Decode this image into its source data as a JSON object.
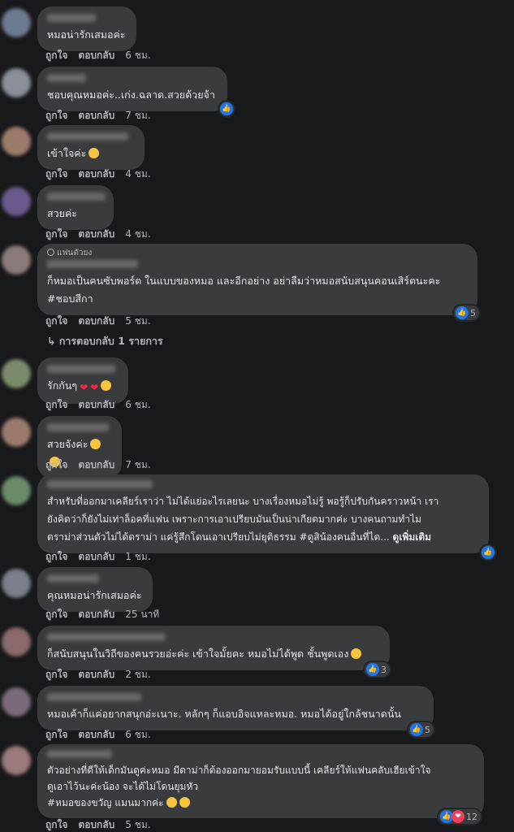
{
  "comments": [
    {
      "text": "หมอน่ารักเสมอค่ะ",
      "like": "ถูกใจ",
      "reply": "ตอบกลับ",
      "time": "6 ชม.",
      "avatar_color": "#6c7a8f"
    },
    {
      "text": "ชอบคุณหมอค่ะ..เก่ง.ฉลาด.สวยด้วยจ้า",
      "like": "ถูกใจ",
      "reply": "ตอบกลับ",
      "time": "7 ชม.",
      "avatar_color": "#8a8f99"
    },
    {
      "text": "เข้าใจค่ะ",
      "like": "ถูกใจ",
      "reply": "ตอบกลับ",
      "time": "4 ชม.",
      "avatar_color": "#9b7b6a"
    },
    {
      "text": "สวยค่ะ",
      "like": "ถูกใจ",
      "reply": "ตอบกลับ",
      "time": "4 ชม.",
      "avatar_color": "#6a5a8c"
    },
    {
      "badge": "แฟนตัวยง",
      "text": "ก็หมอเป็นคนซับพอร์ต ในแบบของหมอ และอีกอย่าง อย่าลืมว่าหมอสนับสนุนคอนเสิร์ตนะคะ\n#ชอบสีกา",
      "like": "ถูกใจ",
      "reply": "ตอบกลับ",
      "time": "5 ชม.",
      "reactions": "5",
      "avatar_color": "#8a7a7a"
    },
    {
      "text": "รักกันๆ",
      "like": "ถูกใจ",
      "reply": "ตอบกลับ",
      "time": "6 ชม.",
      "avatar_color": "#7a8a6a"
    },
    {
      "text": "สวยจังค่ะ",
      "like": "ถูกใจ",
      "reply": "ตอบกลับ",
      "time": "7 ชม.",
      "avatar_color": "#9a7a6a"
    },
    {
      "text": "สำหรับที่ออกมาเคลียร์เราว่า ไม่ได้แย่อะไรเลยนะ บางเรื่องหมอไม่รู้ พอรู้ก็ปรับกันคราวหน้า เรา\nยังคิดว่าก็ยังไม่เท่าล็อคที่แฟน เพราะการเอาเปรียบมันเป็นน่าเกียดมากค่ะ บางคนถามทำไม\nดราม่าส่วนตัวไม่ได้ดราม่า แค่รู้สึกโดนเอาเปรียบไม่ยุติธรรม #ดูสิน้องคนอื่นที่ได...",
      "see_more": "ดูเพิ่มเติม",
      "like": "ถูกใจ",
      "reply": "ตอบกลับ",
      "time": "1 ชม.",
      "avatar_color": "#6a8a6a"
    },
    {
      "text": "คุณหมอน่ารักเสมอค่ะ",
      "like": "ถูกใจ",
      "reply": "ตอบกลับ",
      "time": "25 นาที",
      "avatar_color": "#7a7f8a"
    },
    {
      "text": "ก็สนับสนุนในวิถีของคนรวยอ่ะค่ะ เข้าใจมั้ยคะ หมอไม่ได้พูด ชั้นพูดเอง",
      "like": "ถูกใจ",
      "reply": "ตอบกลับ",
      "time": "2 ชม.",
      "reactions": "3",
      "avatar_color": "#8a6a6a"
    },
    {
      "text": "หมอเค้าก็แค่อยากสนุกอ่ะเนาะ. หลักๆ ก็แอบอิจแหละหมอ. หมอได้อยู่ใกล้ชนาดนั้น",
      "like": "ถูกใจ",
      "reply": "ตอบกลับ",
      "time": "6 ชม.",
      "reactions": "5",
      "avatar_color": "#7a6a7a"
    },
    {
      "text": "ตัวอย่างที่ดีให้เด็กมันดูค่ะหมอ มีดาม่าก็ต้องออกมายอมรับแบบนี้ เคลียร์ให้แฟนคลับเฮียเข้าใจ\nดูเอาไว้นะค่ะน้อง จะได้ไม่โดนยุมหัว\n#หมอของขวัญ แมนมากค่ะ",
      "like": "ถูกใจ",
      "reply": "ตอบกลับ",
      "time": "5 ชม.",
      "reactions": "12",
      "avatar_color": "#9a7a7a"
    }
  ],
  "replies_link": "การตอบกลับ 1 รายการ",
  "icons": {
    "like": "thumbs-up-icon",
    "love": "heart-icon",
    "reply_arrow": "reply-arrow-icon"
  },
  "colors": {
    "background": "#18191a",
    "bubble": "#3a3b3c",
    "like_blue": "#1877f2",
    "love_red": "#f33e58"
  }
}
